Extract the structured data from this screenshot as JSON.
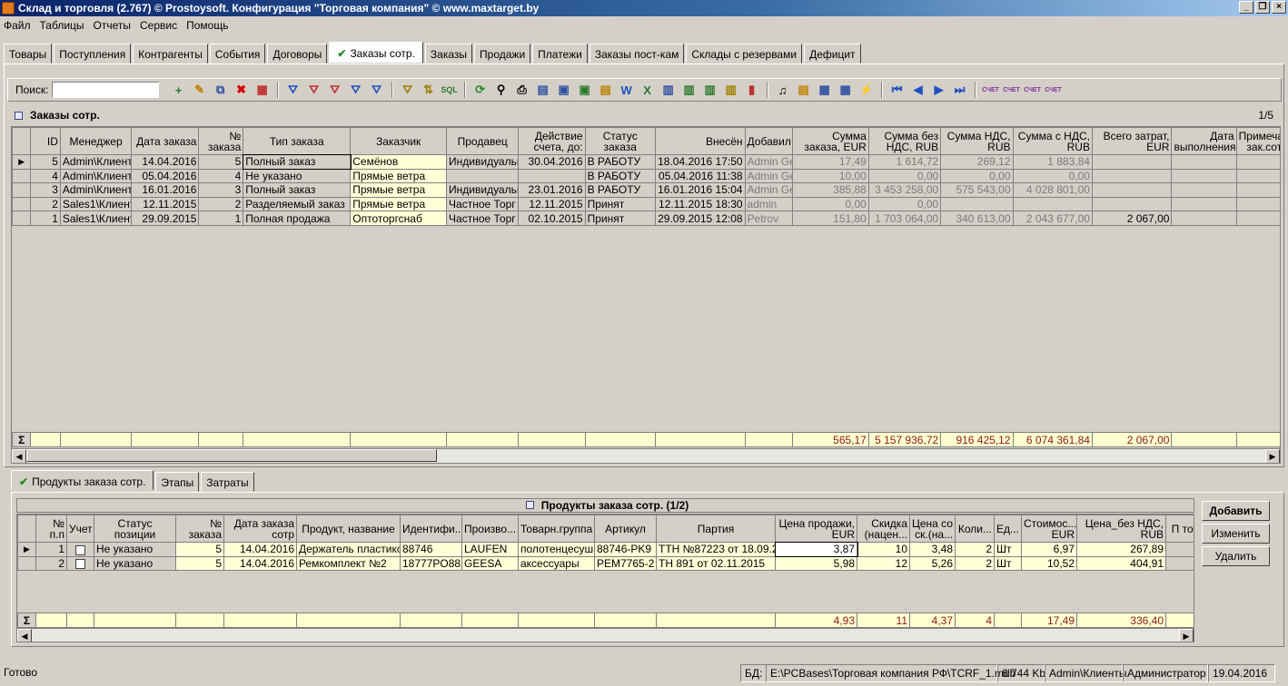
{
  "window": {
    "title": "Склад и торговля (2.767) © Prostoysoft. Конфигурация \"Торговая компания\" © www.maxtarget.by"
  },
  "menu": [
    "Файл",
    "Таблицы",
    "Отчеты",
    "Сервис",
    "Помощь"
  ],
  "tabs": [
    "Товары",
    "Поступления",
    "Контрагенты",
    "События",
    "Договоры",
    "Заказы сотр.",
    "Заказы",
    "Продажи",
    "Платежи",
    "Заказы пост-кам",
    "Склады с резервами",
    "Дефицит"
  ],
  "search": {
    "label": "Поиск:",
    "value": ""
  },
  "orders": {
    "title": "Заказы сотр.",
    "pager": "1/5",
    "columns": [
      "ID",
      "Менеджер",
      "Дата заказа",
      "№ заказа",
      "Тип заказа",
      "Заказчик",
      "Продавец",
      "Действие счета, до:",
      "Статус заказа",
      "Внесён",
      "Добавил",
      "Сумма заказа, EUR",
      "Сумма без НДС, RUB",
      "Сумма НДС, RUB",
      "Сумма с НДС, RUB",
      "Всего затрат, EUR",
      "Дата выполнения",
      "Примечания зак.сотр."
    ],
    "rows": [
      [
        "5",
        "Admin\\Клиент",
        "14.04.2016",
        "5",
        "Полный заказ",
        "Семёнов",
        "Индивидуальн",
        "30.04.2016",
        "В РАБОТУ",
        "18.04.2016 17:50",
        "Admin Ge",
        "17,49",
        "1 614,72",
        "269,12",
        "1 883,84",
        "",
        "",
        ""
      ],
      [
        "4",
        "Admin\\Клиент",
        "05.04.2016",
        "4",
        "Не указано",
        "Прямые ветра",
        "",
        "",
        "В РАБОТУ",
        "05.04.2016 11:38",
        "Admin Ge",
        "10,00",
        "0,00",
        "0,00",
        "0,00",
        "",
        "",
        ""
      ],
      [
        "3",
        "Admin\\Клиент",
        "16.01.2016",
        "3",
        "Полный заказ",
        "Прямые ветра",
        "Индивидуальн",
        "23.01.2016",
        "В РАБОТУ",
        "16.01.2016 15:04",
        "Admin Ge",
        "385,88",
        "3 453 258,00",
        "575 543,00",
        "4 028 801,00",
        "",
        "",
        ""
      ],
      [
        "2",
        "Sales1\\Клиент",
        "12.11.2015",
        "2",
        "Разделяемый заказ",
        "Прямые ветра",
        "Частное Торг",
        "12.11.2015",
        "Принят",
        "12.11.2015 18:30",
        "admin",
        "0,00",
        "0,00",
        "",
        "",
        "",
        "",
        ""
      ],
      [
        "1",
        "Sales1\\Клиент",
        "29.09.2015",
        "1",
        "Полная продажа",
        "Оптоторгснаб",
        "Частное Торг",
        "02.10.2015",
        "Принят",
        "29.09.2015 12:08",
        "Petrov",
        "151,80",
        "1 703 064,00",
        "340 613,00",
        "2 043 677,00",
        "2 067,00",
        "",
        ""
      ]
    ],
    "totals": [
      "",
      "",
      "",
      "",
      "",
      "",
      "",
      "",
      "",
      "",
      "",
      "565,17",
      "5 157 936,72",
      "916 425,12",
      "6 074 361,84",
      "2 067,00",
      "",
      ""
    ]
  },
  "bottom_tabs": [
    "Продукты заказа сотр.",
    "Этапы",
    "Затраты"
  ],
  "products": {
    "title": "Продукты заказа сотр. (1/2)",
    "columns": [
      "№ п.п",
      "Учет",
      "Статус позиции",
      "№ заказа",
      "Дата заказа сотр",
      "Продукт, название",
      "Идентифи...",
      "Произво...",
      "Товарн.группа",
      "Артикул",
      "Партия",
      "Цена продажи, EUR",
      "Скидка (нацен...",
      "Цена со ск.(на...",
      "Коли...",
      "Ед...",
      "Стоимос... EUR",
      "Цена_без НДС, RUB",
      "П тов."
    ],
    "rows": [
      [
        "1",
        "",
        "Не указано",
        "5",
        "14.04.2016",
        "Держатель пластикс",
        "88746",
        "LAUFEN",
        "полотенцесуши",
        "88746-PK9",
        "ТТН №87223 от 18.09.20",
        "3,87",
        "10",
        "3,48",
        "2",
        "Шт",
        "6,97",
        "267,89",
        ""
      ],
      [
        "2",
        "",
        "Не указано",
        "5",
        "14.04.2016",
        "Ремкомплект №2",
        "18777PO88",
        "GEESA",
        "аксессуары",
        "PEM7765-2",
        "ТН 891 от 02.11.2015",
        "5,98",
        "12",
        "5,26",
        "2",
        "Шт",
        "10,52",
        "404,91",
        ""
      ]
    ],
    "totals": [
      "",
      "",
      "",
      "",
      "",
      "",
      "",
      "",
      "",
      "",
      "",
      "4,93",
      "11",
      "4,37",
      "4",
      "",
      "17,49",
      "336,40",
      ""
    ]
  },
  "buttons": {
    "add": "Добавить",
    "edit": "Изменить",
    "delete": "Удалить"
  },
  "status": {
    "ready": "Готово",
    "db_label": "БД:",
    "db_path": "E:\\PCBases\\Торговая компания РФ\\TCRF_1.mdb",
    "size": "6 744 Kb",
    "user": "Admin\\Клиенты",
    "role": "Администратор",
    "date": "19.04.2016"
  }
}
